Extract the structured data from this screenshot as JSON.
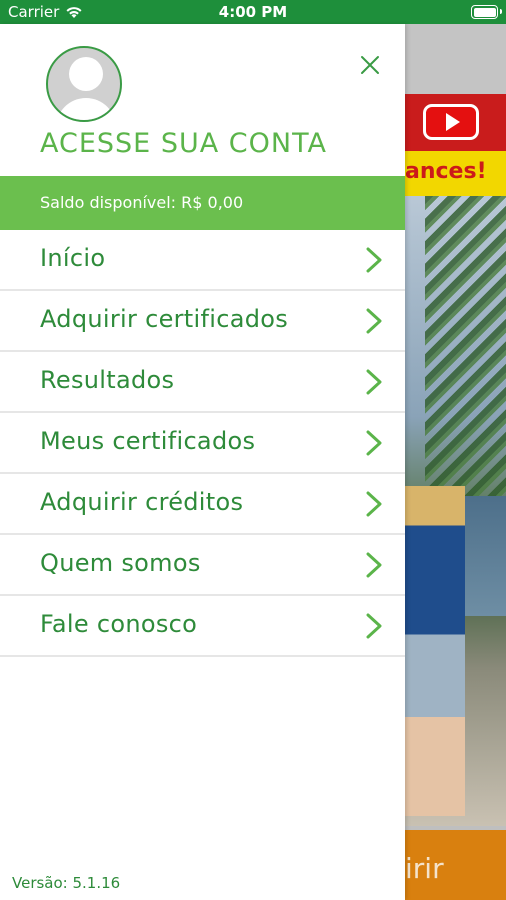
{
  "status_bar": {
    "carrier": "Carrier",
    "time": "4:00 PM"
  },
  "drawer": {
    "account_title": "ACESSE SUA CONTA",
    "balance_label": "Saldo disponível: R$ 0,00",
    "menu_items": [
      {
        "label": "Início"
      },
      {
        "label": "Adquirir certificados"
      },
      {
        "label": "Resultados"
      },
      {
        "label": "Meus certificados"
      },
      {
        "label": "Adquirir créditos"
      },
      {
        "label": "Quem somos"
      },
      {
        "label": "Fale conosco"
      }
    ],
    "version": "Versão: 5.1.16"
  },
  "background_app": {
    "banner_text": "ances!",
    "footer_text": "irir"
  },
  "colors": {
    "status_bar_bg": "#1e8f3b",
    "brand_green": "#6bbf4e",
    "menu_text": "#2e8b3a",
    "chevron": "#5bb44a"
  }
}
